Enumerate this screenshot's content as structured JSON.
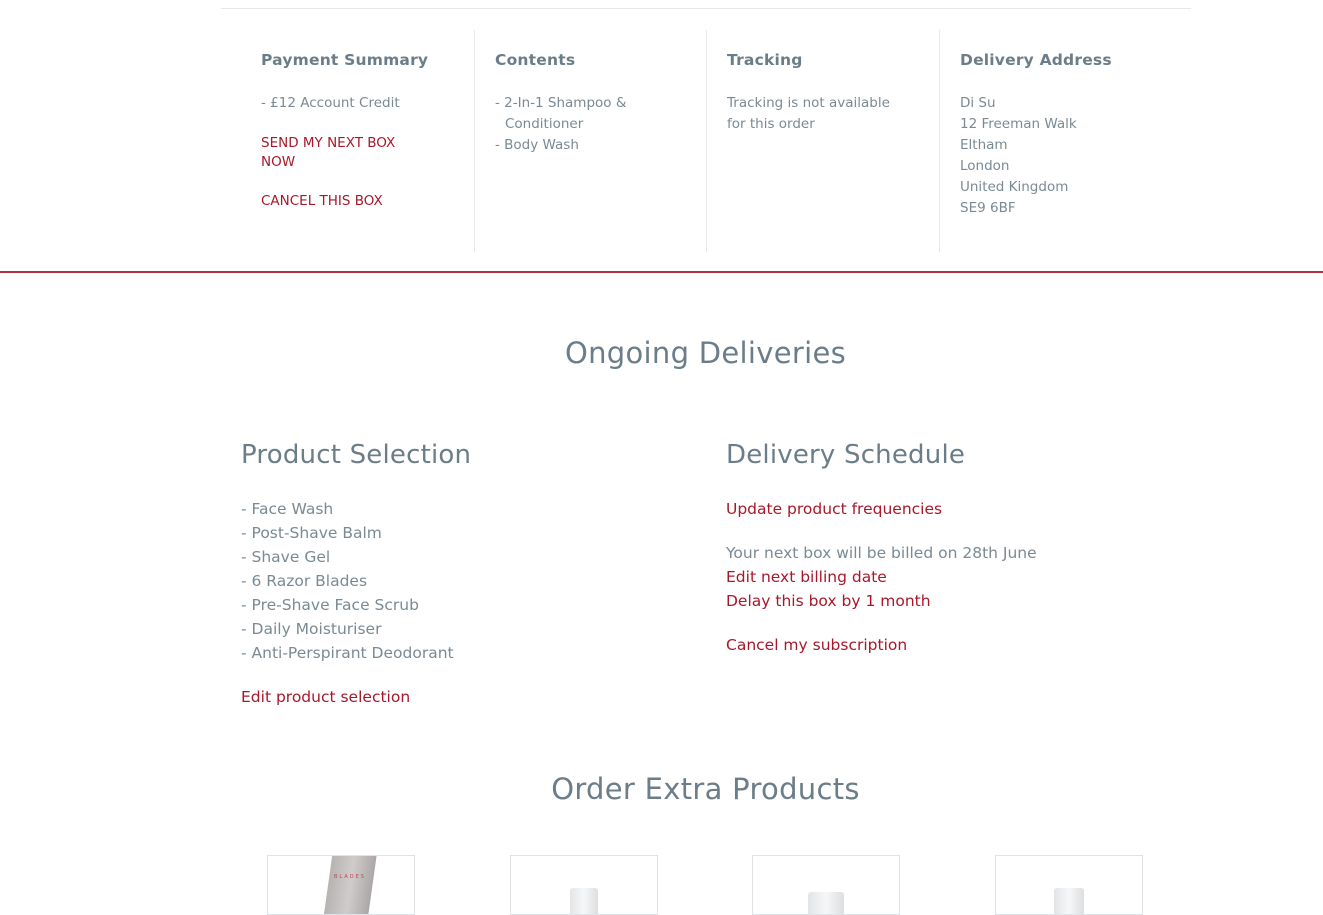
{
  "current_box": {
    "payment": {
      "heading": "Payment Summary",
      "lines": [
        "- £12 Account Credit"
      ],
      "send_next_label": "SEND MY NEXT BOX NOW",
      "cancel_label": "CANCEL THIS BOX"
    },
    "contents": {
      "heading": "Contents",
      "item1_line1": "- 2-In-1 Shampoo &",
      "item1_line2": "Conditioner",
      "item2": "- Body Wash"
    },
    "tracking": {
      "heading": "Tracking",
      "line1": "Tracking is not available",
      "line2": "for this order"
    },
    "address": {
      "heading": "Delivery Address",
      "lines": [
        "Di Su",
        "12 Freeman Walk",
        "Eltham",
        "London",
        "United Kingdom",
        "SE9 6BF"
      ]
    }
  },
  "ongoing": {
    "title": "Ongoing Deliveries",
    "product_selection": {
      "heading": "Product Selection",
      "items": [
        "- Face Wash",
        "- Post-Shave Balm",
        "- Shave Gel",
        "- 6 Razor Blades",
        "- Pre-Shave Face Scrub",
        "- Daily Moisturiser",
        "- Anti-Perspirant Deodorant"
      ],
      "edit_label": "Edit product selection"
    },
    "delivery_schedule": {
      "heading": "Delivery Schedule",
      "update_frequencies_label": "Update product frequencies",
      "billing_info": "Your next box will be billed on 28th June",
      "edit_billing_label": "Edit next billing date",
      "delay_label": "Delay this box by 1 month",
      "cancel_label": "Cancel my subscription"
    }
  },
  "extras": {
    "title": "Order Extra Products",
    "card1_brand": "BLADES"
  },
  "colors": {
    "accent": "#a8182a",
    "heading": "#6b7d88",
    "text": "#7a8a94",
    "divider": "#b8303f"
  }
}
